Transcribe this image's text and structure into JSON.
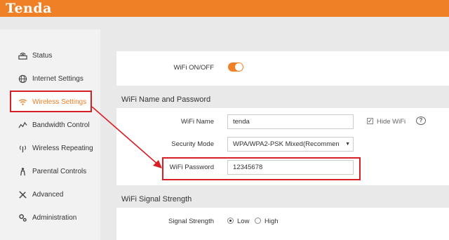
{
  "header": {
    "brand": "Tenda",
    "accent_color": "#f08026"
  },
  "sidebar": {
    "items": [
      {
        "label": "Status",
        "icon": "status-icon"
      },
      {
        "label": "Internet Settings",
        "icon": "globe-icon"
      },
      {
        "label": "Wireless Settings",
        "icon": "wifi-icon",
        "active": true
      },
      {
        "label": "Bandwidth Control",
        "icon": "bandwidth-icon"
      },
      {
        "label": "Wireless Repeating",
        "icon": "repeater-icon"
      },
      {
        "label": "Parental Controls",
        "icon": "parental-icon"
      },
      {
        "label": "Advanced",
        "icon": "tools-icon"
      },
      {
        "label": "Administration",
        "icon": "gear-icon"
      }
    ]
  },
  "wifi_toggle": {
    "label": "WiFi ON/OFF",
    "on": true
  },
  "name_password": {
    "title": "WiFi Name and Password",
    "wifi_name_label": "WiFi Name",
    "wifi_name_value": "tenda",
    "hide_wifi_label": "Hide WiFi",
    "hide_wifi_checked": true,
    "help_symbol": "?",
    "security_mode_label": "Security Mode",
    "security_mode_value": "WPA/WPA2-PSK Mixed(Recommen",
    "password_label": "WiFi Password",
    "password_value": "12345678"
  },
  "signal": {
    "title": "WiFi Signal Strength",
    "label": "Signal Strength",
    "options": [
      "Low",
      "High"
    ],
    "selected": "Low"
  },
  "annotation_color": "#d81f26"
}
